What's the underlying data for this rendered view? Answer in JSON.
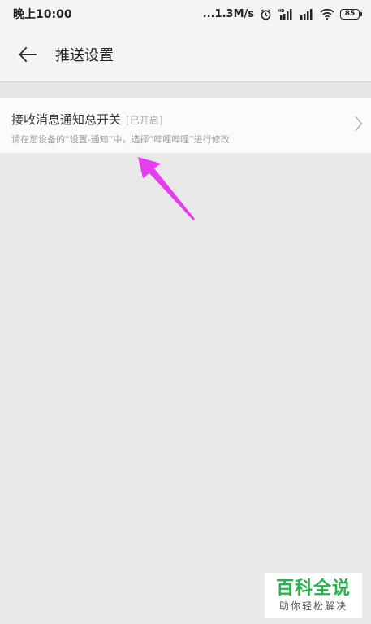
{
  "status_bar": {
    "time": "晚上10:00",
    "net_speed": "...1.3M/s",
    "battery": "85",
    "icons": [
      "alarm-icon",
      "signal-icon",
      "signal-icon",
      "wifi-icon",
      "battery-icon"
    ]
  },
  "header": {
    "back_icon": "back-arrow-icon",
    "title": "推送设置"
  },
  "setting": {
    "title": "接收消息通知总开关",
    "status": "[已开启]",
    "description": "请在您设备的“设置-通知”中，选择“哔哩哔哩”进行修改",
    "chevron_icon": "chevron-right-icon"
  },
  "annotation": {
    "color": "#e83cf0"
  },
  "watermark": {
    "main": "百科全说",
    "sub": "助你轻松解决"
  }
}
